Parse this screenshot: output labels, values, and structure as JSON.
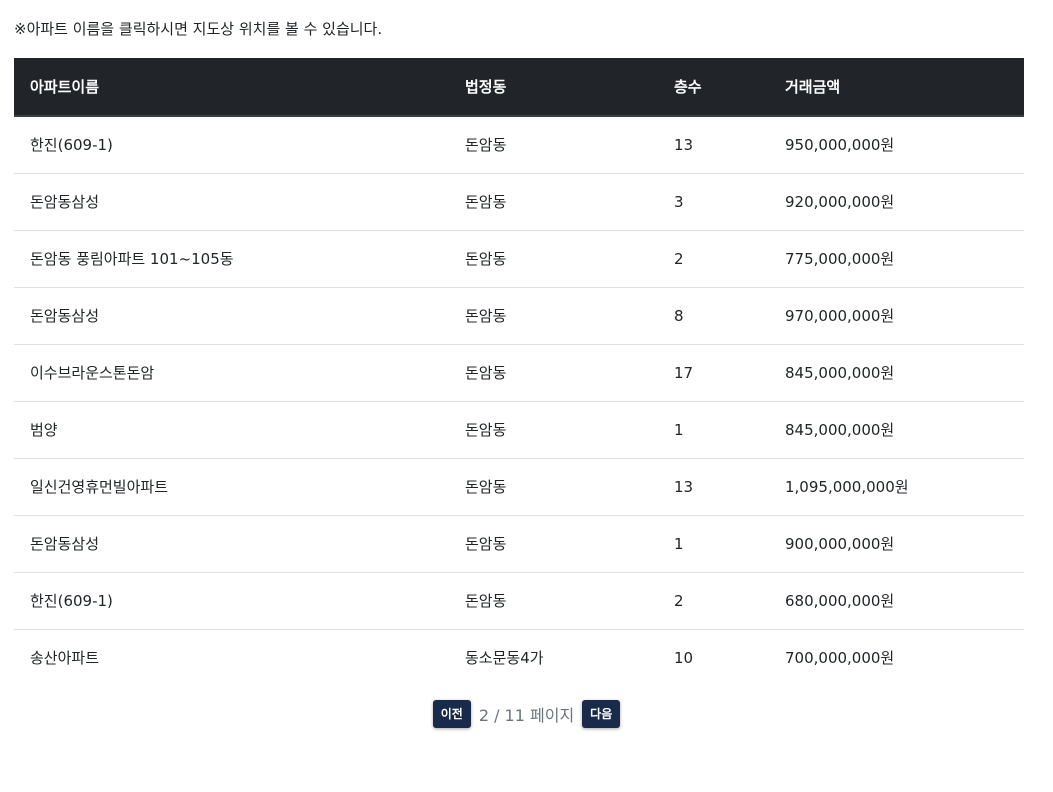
{
  "notice": "※아파트 이름을 클릭하시면 지도상 위치를 볼 수 있습니다.",
  "table": {
    "headers": [
      "아파트이름",
      "법정동",
      "층수",
      "거래금액"
    ],
    "rows": [
      {
        "name": "한진(609-1)",
        "dong": "돈암동",
        "floor": "13",
        "price": "950,000,000원"
      },
      {
        "name": "돈암동삼성",
        "dong": "돈암동",
        "floor": "3",
        "price": "920,000,000원"
      },
      {
        "name": "돈암동 풍림아파트 101~105동",
        "dong": "돈암동",
        "floor": "2",
        "price": "775,000,000원"
      },
      {
        "name": "돈암동삼성",
        "dong": "돈암동",
        "floor": "8",
        "price": "970,000,000원"
      },
      {
        "name": "이수브라운스톤돈암",
        "dong": "돈암동",
        "floor": "17",
        "price": "845,000,000원"
      },
      {
        "name": "범양",
        "dong": "돈암동",
        "floor": "1",
        "price": "845,000,000원"
      },
      {
        "name": "일신건영휴먼빌아파트",
        "dong": "돈암동",
        "floor": "13",
        "price": "1,095,000,000원"
      },
      {
        "name": "돈암동삼성",
        "dong": "돈암동",
        "floor": "1",
        "price": "900,000,000원"
      },
      {
        "name": "한진(609-1)",
        "dong": "돈암동",
        "floor": "2",
        "price": "680,000,000원"
      },
      {
        "name": "송산아파트",
        "dong": "동소문동4가",
        "floor": "10",
        "price": "700,000,000원"
      }
    ]
  },
  "pagination": {
    "prev_label": "이전",
    "page_info": "2 / 11 페이지",
    "next_label": "다음"
  },
  "colors": {
    "header_bg": "#212529",
    "button_bg": "#1a2a4a"
  }
}
